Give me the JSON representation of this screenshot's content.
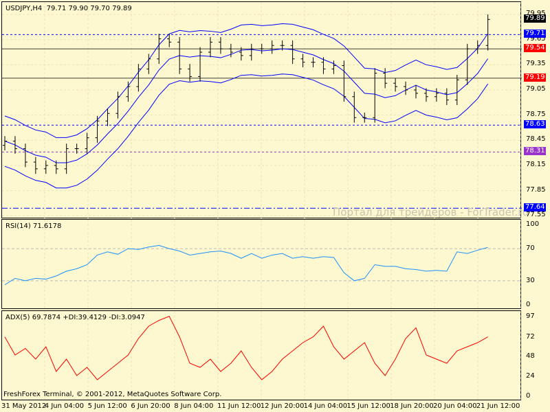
{
  "header": {
    "symbol_line": "USDJPY,H4  79.71 79.90 79.70 79.89"
  },
  "rsi_title": "RSI(14) 71.6178",
  "adx_title": "ADX(5) 69.7874 +DI:39.4129 -DI:3.0947",
  "watermark": "Портал для трейдеров - ForTrader.ru",
  "copyright": "FreshForex Terminal, © 2001-2012, MetaQuotes Software Corp.",
  "price_axis": [
    "79.95",
    "79.65",
    "79.35",
    "79.05",
    "78.75",
    "78.45",
    "78.15",
    "77.85",
    "77.55"
  ],
  "price_tags": [
    {
      "value": "79.89",
      "color": "#000000",
      "style": "none"
    },
    {
      "value": "79.71",
      "color": "#0000ff",
      "style": "dash"
    },
    {
      "value": "79.54",
      "color": "#ff0000",
      "style": "solid"
    },
    {
      "value": "79.19",
      "color": "#ff0000",
      "style": "solid"
    },
    {
      "value": "78.63",
      "color": "#0000ff",
      "style": "dash"
    },
    {
      "value": "78.31",
      "color": "#9933cc",
      "style": "dash"
    },
    {
      "value": "77.64",
      "color": "#0000ff",
      "style": "dashdot"
    }
  ],
  "rsi_axis": [
    "100",
    "70",
    "30",
    "0"
  ],
  "adx_axis": [
    "97",
    "72",
    "48",
    "24",
    "0"
  ],
  "time_labels": [
    "31 May 2012",
    "4 Jun 04:00",
    "5 Jun 12:00",
    "6 Jun 20:00",
    "8 Jun 04:00",
    "11 Jun 12:00",
    "12 Jun 20:00",
    "14 Jun 04:00",
    "15 Jun 12:00",
    "18 Jun 20:00",
    "20 Jun 04:00",
    "21 Jun 12:00"
  ],
  "chart_data": {
    "type": "line",
    "closes": [
      78.44,
      78.35,
      78.19,
      78.11,
      78.15,
      78.11,
      78.35,
      78.35,
      78.48,
      78.68,
      78.77,
      78.97,
      79.09,
      79.3,
      79.42,
      79.66,
      79.62,
      79.3,
      79.21,
      79.5,
      79.62,
      79.54,
      79.5,
      79.46,
      79.54,
      79.54,
      79.58,
      79.58,
      79.42,
      79.38,
      79.38,
      79.3,
      79.34,
      78.97,
      78.72,
      78.72,
      79.25,
      79.13,
      79.09,
      79.05,
      79.01,
      78.97,
      79.01,
      78.93,
      79.17,
      79.54,
      79.58,
      79.89
    ],
    "rsi": [
      25,
      33,
      30,
      33,
      32,
      36,
      42,
      45,
      50,
      62,
      66,
      63,
      70,
      69,
      72,
      74,
      70,
      67,
      62,
      64,
      66,
      67,
      64,
      58,
      64,
      58,
      62,
      64,
      58,
      60,
      58,
      60,
      59,
      40,
      30,
      33,
      50,
      48,
      48,
      45,
      44,
      42,
      43,
      42,
      66,
      64,
      68,
      71.6
    ],
    "adx": [
      72,
      50,
      58,
      45,
      60,
      30,
      45,
      25,
      35,
      20,
      30,
      40,
      50,
      70,
      85,
      92,
      97,
      72,
      40,
      35,
      45,
      30,
      40,
      55,
      35,
      20,
      30,
      45,
      55,
      65,
      72,
      85,
      60,
      45,
      55,
      65,
      40,
      25,
      45,
      70,
      83,
      50,
      45,
      40,
      55,
      60,
      65,
      72
    ],
    "price_range": [
      77.55,
      79.95
    ],
    "colors": {
      "bands": "#0000ff",
      "bars": "#000000",
      "rsi": "#1e90ff",
      "adx": "#ff0000"
    }
  }
}
